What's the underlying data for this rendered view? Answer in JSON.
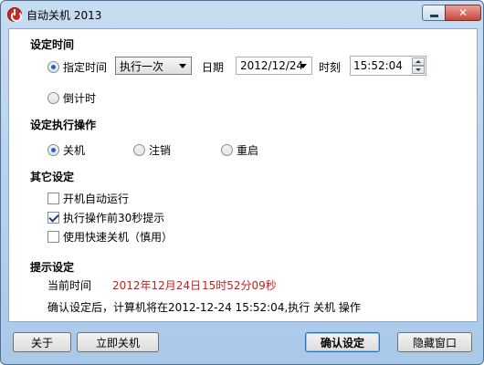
{
  "window": {
    "title": "自动关机 2013"
  },
  "set_time": {
    "section_title": "设定时间",
    "option_specified": "指定时间",
    "option_countdown": "倒计时",
    "frequency_value": "执行一次",
    "date_label": "日期",
    "date_value": "2012/12/24",
    "time_label": "时刻",
    "time_value": "15:52:04"
  },
  "action": {
    "section_title": "设定执行操作",
    "options": [
      "关机",
      "注销",
      "重启"
    ]
  },
  "other": {
    "section_title": "其它设定",
    "checkboxes": [
      {
        "label": "开机自动运行",
        "checked": false
      },
      {
        "label": "执行操作前30秒提示",
        "checked": true
      },
      {
        "label": "使用快速关机（慎用）",
        "checked": false
      }
    ]
  },
  "info": {
    "section_title": "提示设定",
    "current_time_label": "当前时间",
    "current_date": "2012年12月24日",
    "current_clock": "15时52分09秒",
    "confirm_message": "确认设定后，计算机将在2012-12-24 15:52:04,执行 关机 操作"
  },
  "buttons": {
    "about": "关于",
    "shutdown_now": "立即关机",
    "confirm": "确认设定",
    "hide": "隐藏窗口"
  },
  "colors": {
    "accent": "#2163c7",
    "highlight_text": "#c42020"
  }
}
